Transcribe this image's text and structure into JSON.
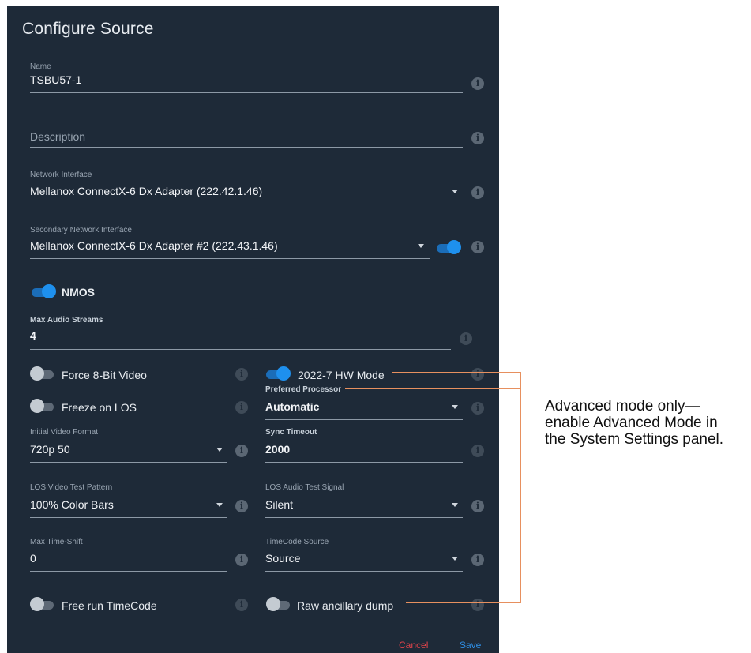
{
  "dialog": {
    "title": "Configure Source",
    "name": {
      "label": "Name",
      "value": "TSBU57-1"
    },
    "description": {
      "placeholder": "Description"
    },
    "network_interface": {
      "label": "Network Interface",
      "value": "Mellanox ConnectX-6 Dx Adapter (222.42.1.46)"
    },
    "secondary_interface": {
      "label": "Secondary Network Interface",
      "value": "Mellanox ConnectX-6 Dx Adapter #2 (222.43.1.46)",
      "enabled": true
    },
    "nmos": {
      "label": "NMOS",
      "enabled": true
    },
    "max_audio_streams": {
      "label": "Max Audio Streams",
      "value": "4"
    },
    "force_8bit": {
      "label": "Force 8-Bit Video",
      "enabled": false
    },
    "hw_mode": {
      "label": "2022-7 HW Mode",
      "enabled": true
    },
    "preferred_processor": {
      "label": "Preferred Processor",
      "value": "Automatic"
    },
    "freeze_los": {
      "label": "Freeze on LOS",
      "enabled": false
    },
    "initial_video_format": {
      "label": "Initial Video Format",
      "value": "720p 50"
    },
    "sync_timeout": {
      "label": "Sync Timeout",
      "value": "2000"
    },
    "los_video_pattern": {
      "label": "LOS Video Test Pattern",
      "value": "100% Color Bars"
    },
    "los_audio_signal": {
      "label": "LOS Audio Test Signal",
      "value": "Silent"
    },
    "max_time_shift": {
      "label": "Max Time-Shift",
      "value": "0"
    },
    "timecode_source": {
      "label": "TimeCode Source",
      "value": "Source"
    },
    "free_run_timecode": {
      "label": "Free run TimeCode",
      "enabled": false
    },
    "raw_ancillary_dump": {
      "label": "Raw ancillary dump",
      "enabled": false
    },
    "cancel_label": "Cancel",
    "save_label": "Save"
  },
  "annotation": {
    "line1": "Advanced mode only—",
    "line2": "enable Advanced Mode in",
    "line3": "the System Settings panel."
  },
  "colors": {
    "dialog_bg": "#1e2a38",
    "accent": "#1e90ee",
    "cancel": "#e0434a",
    "save": "#2f8fe6",
    "leader": "#e7905f"
  }
}
